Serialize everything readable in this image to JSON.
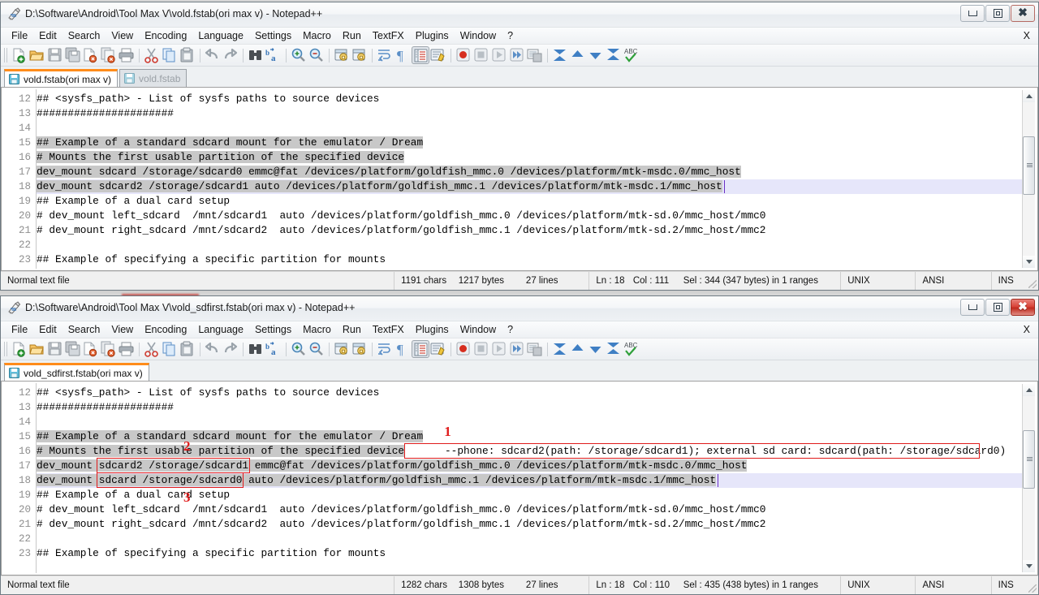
{
  "desktop": {
    "ghost_text": "D:\\Software\\Android\\Tool Max V\\vold.fstab(ori max v) - Notepad++"
  },
  "menu": {
    "items": [
      "File",
      "Edit",
      "Search",
      "View",
      "Encoding",
      "Language",
      "Settings",
      "Macro",
      "Run",
      "TextFX",
      "Plugins",
      "Window",
      "?"
    ],
    "right_label": "X"
  },
  "toolbar": {
    "icons": [
      "new-file-icon",
      "open-file-icon",
      "save-icon",
      "save-all-icon",
      "close-file-icon",
      "close-all-icon",
      "print-icon",
      "cut-icon",
      "copy-icon",
      "paste-icon",
      "undo-icon",
      "redo-icon",
      "find-icon",
      "replace-icon",
      "zoom-in-icon",
      "zoom-out-icon",
      "sync-vertical-scroll-icon",
      "sync-horizontal-scroll-icon",
      "word-wrap-icon",
      "show-all-chars-icon",
      "indent-guide-icon",
      "user-defined-dialog-icon",
      "record-macro-icon",
      "stop-recording-icon",
      "play-macro-icon",
      "run-macro-multiple-icon",
      "save-macro-icon",
      "collapse-all-icon",
      "collapse-level-icon",
      "expand-level-icon",
      "expand-all-icon",
      "spell-check-icon"
    ]
  },
  "window1": {
    "title": "D:\\Software\\Android\\Tool Max V\\vold.fstab(ori max v) - Notepad++",
    "title_icon": "notepad-plus-plus-icon",
    "controls": {
      "minimize": "minimize-button",
      "maximize": "maximize-button",
      "close": "close-button",
      "close_hot": false
    },
    "tabs": [
      {
        "label": "vold.fstab(ori max v)",
        "active": true,
        "icon": "saved-file-icon"
      },
      {
        "label": "vold.fstab",
        "active": false,
        "icon": "saved-file-icon"
      }
    ],
    "code_lines": [
      {
        "num": "12",
        "text": "## <sysfs_path> - List of sysfs paths to source devices",
        "selected": false,
        "current": false
      },
      {
        "num": "13",
        "text": "######################",
        "selected": false,
        "current": false
      },
      {
        "num": "14",
        "text": "",
        "selected": false,
        "current": false
      },
      {
        "num": "15",
        "text": "## Example of a standard sdcard mount for the emulator / Dream",
        "selected": true,
        "current": false
      },
      {
        "num": "16",
        "text": "# Mounts the first usable partition of the specified device",
        "selected": true,
        "current": false
      },
      {
        "num": "17",
        "text": "dev_mount sdcard /storage/sdcard0 emmc@fat /devices/platform/goldfish_mmc.0 /devices/platform/mtk-msdc.0/mmc_host",
        "selected": true,
        "current": false
      },
      {
        "num": "18",
        "text": "dev_mount sdcard2 /storage/sdcard1 auto /devices/platform/goldfish_mmc.1 /devices/platform/mtk-msdc.1/mmc_host",
        "selected": true,
        "current": true
      },
      {
        "num": "19",
        "text": "## Example of a dual card setup",
        "selected": false,
        "current": false
      },
      {
        "num": "20",
        "text": "# dev_mount left_sdcard  /mnt/sdcard1  auto /devices/platform/goldfish_mmc.0 /devices/platform/mtk-sd.0/mmc_host/mmc0",
        "selected": false,
        "current": false
      },
      {
        "num": "21",
        "text": "# dev_mount right_sdcard /mnt/sdcard2  auto /devices/platform/goldfish_mmc.1 /devices/platform/mtk-sd.2/mmc_host/mmc2",
        "selected": false,
        "current": false
      },
      {
        "num": "22",
        "text": "",
        "selected": false,
        "current": false
      },
      {
        "num": "23",
        "text": "## Example of specifying a specific partition for mounts",
        "selected": false,
        "current": false
      }
    ],
    "status": {
      "file_type": "Normal text file",
      "chars": "1191 chars",
      "bytes": "1217 bytes",
      "lines": "27 lines",
      "ln": "Ln : 18",
      "col": "Col : 111",
      "sel": "Sel : 344 (347 bytes) in 1 ranges",
      "eol": "UNIX",
      "encoding": "ANSI",
      "insert_mode": "INS"
    }
  },
  "window2": {
    "title": "D:\\Software\\Android\\Tool Max V\\vold_sdfirst.fstab(ori max v) - Notepad++",
    "title_icon": "notepad-plus-plus-icon",
    "controls": {
      "minimize": "minimize-button",
      "maximize": "maximize-button",
      "close": "close-button",
      "close_hot": true
    },
    "tabs": [
      {
        "label": "vold_sdfirst.fstab(ori max v)",
        "active": true,
        "icon": "saved-file-icon"
      }
    ],
    "code_lines": [
      {
        "num": "12",
        "text": "## <sysfs_path> - List of sysfs paths to source devices",
        "selected": false,
        "current": false
      },
      {
        "num": "13",
        "text": "######################",
        "selected": false,
        "current": false
      },
      {
        "num": "14",
        "text": "",
        "selected": false,
        "current": false
      },
      {
        "num": "15",
        "text": "## Example of a standard sdcard mount for the emulator / Dream",
        "selected": true,
        "current": false
      },
      {
        "num": "16",
        "text": "# Mounts the first usable partition of the specified device",
        "selected": true,
        "current": false
      },
      {
        "num": "17",
        "text": "dev_mount sdcard2 /storage/sdcard1 emmc@fat /devices/platform/goldfish_mmc.0 /devices/platform/mtk-msdc.0/mmc_host",
        "selected": true,
        "current": false
      },
      {
        "num": "18",
        "text": "dev_mount sdcard /storage/sdcard0 auto /devices/platform/goldfish_mmc.1 /devices/platform/mtk-msdc.1/mmc_host",
        "selected": true,
        "current": true
      },
      {
        "num": "19",
        "text": "## Example of a dual card setup",
        "selected": false,
        "current": false
      },
      {
        "num": "20",
        "text": "# dev_mount left_sdcard  /mnt/sdcard1  auto /devices/platform/goldfish_mmc.0 /devices/platform/mtk-sd.0/mmc_host/mmc0",
        "selected": false,
        "current": false
      },
      {
        "num": "21",
        "text": "# dev_mount right_sdcard /mnt/sdcard2  auto /devices/platform/goldfish_mmc.1 /devices/platform/mtk-sd.2/mmc_host/mmc2",
        "selected": false,
        "current": false
      },
      {
        "num": "22",
        "text": "",
        "selected": false,
        "current": false
      },
      {
        "num": "23",
        "text": "## Example of specifying a specific partition for mounts",
        "selected": false,
        "current": false
      }
    ],
    "annotations": {
      "color": "#e01b1b",
      "note_text": "--phone: sdcard2(path: /storage/sdcard1); external sd card: sdcard(path: /storage/sdcard0)",
      "marker_1": "1",
      "marker_2": "2",
      "marker_3": "3"
    },
    "status": {
      "file_type": "Normal text file",
      "chars": "1282 chars",
      "bytes": "1308 bytes",
      "lines": "27 lines",
      "ln": "Ln : 18",
      "col": "Col : 110",
      "sel": "Sel : 435 (438 bytes) in 1 ranges",
      "eol": "UNIX",
      "encoding": "ANSI",
      "insert_mode": "INS"
    }
  }
}
